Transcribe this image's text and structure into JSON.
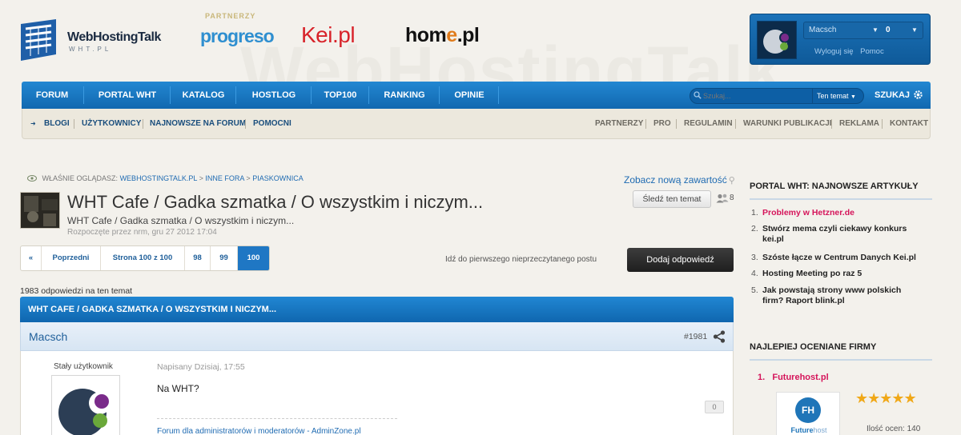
{
  "header": {
    "watermark": "WebHostingTalk",
    "logo_title": "WebHostingTalk",
    "logo_sub": "WHT.PL",
    "partners_label": "PARTNERZY",
    "partners": [
      {
        "name": "progreso"
      },
      {
        "name": "Kei.pl"
      },
      {
        "home_a": "hom",
        "home_b": "e",
        "home_c": ".pl"
      }
    ]
  },
  "user": {
    "name": "Macsch",
    "notifications": "0",
    "logout": "Wyloguj się",
    "help": "Pomoc"
  },
  "nav": {
    "items": [
      {
        "label": "FORUM"
      },
      {
        "label": "PORTAL WHT"
      },
      {
        "label": "KATALOG"
      },
      {
        "label": "HOSTLOG"
      },
      {
        "label": "TOP100"
      },
      {
        "label": "RANKING"
      },
      {
        "label": "OPINIE"
      }
    ],
    "search_placeholder": "Szukaj...",
    "search_scope": "Ten temat",
    "search_button": "SZUKAJ"
  },
  "subnav": {
    "left": [
      {
        "label": "BLOGI"
      },
      {
        "label": "UŻYTKOWNICY"
      },
      {
        "label": "NAJNOWSZE NA FORUM"
      },
      {
        "label": "POMOCNI"
      }
    ],
    "right": [
      {
        "label": "PARTNERZY"
      },
      {
        "label": "PRO"
      },
      {
        "label": "REGULAMIN"
      },
      {
        "label": "WARUNKI PUBLIKACJI"
      },
      {
        "label": "REKLAMA"
      },
      {
        "label": "KONTAKT"
      }
    ]
  },
  "breadcrumb": {
    "prefix": "WŁAŚNIE OGLĄDASZ:",
    "items": [
      "WEBHOSTINGTALK.PL",
      "INNE FORA",
      "PIASKOWNICA"
    ],
    "sep": ">"
  },
  "new_content": "Zobacz nową zawartość",
  "topic": {
    "title": "WHT Cafe / Gadka szmatka / O wszystkim i niczym...",
    "subtitle": "WHT Cafe / Gadka szmatka / O wszystkim i niczym...",
    "meta": "Rozpoczęte przez nrm, gru 27 2012 17:04",
    "follow": "Śledź ten temat",
    "followers": "8"
  },
  "pager": {
    "first": "«",
    "prev": "Poprzedni",
    "page_of": "Strona 100 z 100",
    "pages": [
      "98",
      "99",
      "100"
    ],
    "unread": "Idź do pierwszego nieprzeczytanego postu",
    "reply": "Dodaj odpowiedź"
  },
  "reply_count": "1983 odpowiedzi na ten temat",
  "thread_bar": "WHT CAFE / GADKA SZMATKA / O WSZYSTKIM I NICZYM...",
  "post": {
    "author": "Macsch",
    "number": "#1981",
    "rank": "Stały użytkownik",
    "date": "Napisany Dzisiaj, 17:55",
    "text": "Na WHT?",
    "rep": "0",
    "signature": "Forum dla administratorów i moderatorów - AdminZone.pl"
  },
  "sidebar": {
    "articles_title": "PORTAL WHT: NAJNOWSZE ARTYKUŁY",
    "articles": [
      {
        "n": "1.",
        "t": "Problemy w Hetzner.de"
      },
      {
        "n": "2.",
        "t": "Stwórz mema czyli ciekawy konkurs kei.pl"
      },
      {
        "n": "3.",
        "t": "Szóste łącze w Centrum Danych Kei.pl"
      },
      {
        "n": "4.",
        "t": "Hosting Meeting po raz 5"
      },
      {
        "n": "5.",
        "t": "Jak powstają strony www polskich firm? Raport blink.pl"
      }
    ],
    "firms_title": "NAJLEPIEJ OCENIANE FIRMY",
    "firm": {
      "rank": "1.",
      "name": "Futurehost.pl",
      "logo_initials": "FH",
      "logo_a": "Future",
      "logo_b": "host",
      "stars": "★★★★★",
      "rating_count": "Ilość ocen: 140"
    }
  },
  "colors": {
    "nav_blue": "#1a78c2",
    "accent_pink": "#d5145a",
    "link_blue": "#1f6bb2",
    "button_dark": "#2a2a2a"
  }
}
